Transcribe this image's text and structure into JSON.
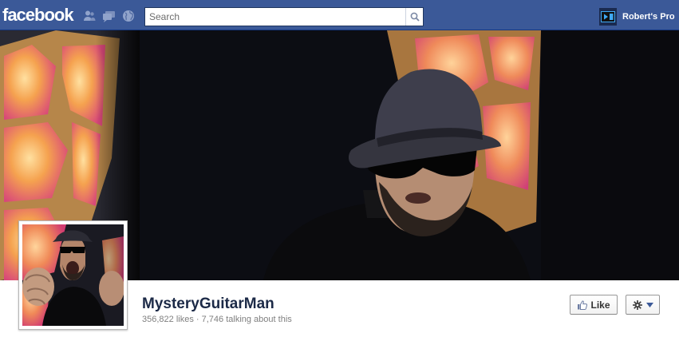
{
  "topbar": {
    "logo": "facebook",
    "jewels": [
      "friend-requests-icon",
      "messages-icon",
      "notifications-globe-icon"
    ],
    "search": {
      "placeholder": "Search",
      "value": ""
    },
    "profile_name": "Robert's Pro"
  },
  "page": {
    "name": "MysteryGuitarMan",
    "likes": "356,822 likes",
    "separator": "·",
    "talking": "7,746 talking about this"
  },
  "actions": {
    "like_label": "Like",
    "settings_icon": "gear-icon"
  },
  "colors": {
    "brand_blue": "#3b5998",
    "name_text": "#1c2a47",
    "muted_text": "#7f7f7f"
  }
}
